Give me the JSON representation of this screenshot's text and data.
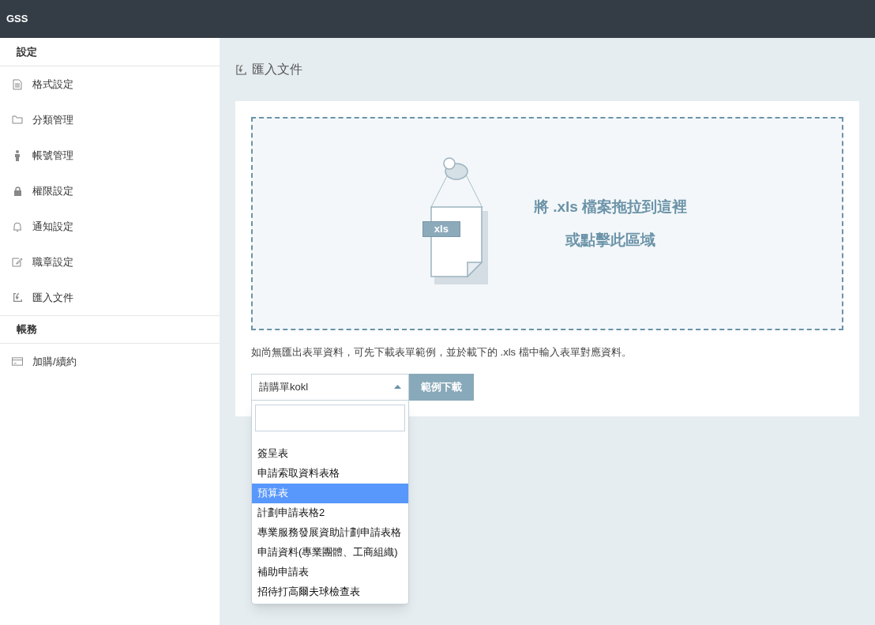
{
  "header": {
    "brand": "GSS"
  },
  "sidebar": {
    "sections": [
      {
        "title": "設定",
        "items": [
          {
            "label": "格式設定",
            "selected": false
          },
          {
            "label": "分類管理",
            "selected": false
          },
          {
            "label": "帳號管理",
            "selected": false
          },
          {
            "label": "權限設定",
            "selected": false
          },
          {
            "label": "通知設定",
            "selected": false
          },
          {
            "label": "職章設定",
            "selected": false
          },
          {
            "label": "匯入文件",
            "selected": false
          }
        ]
      },
      {
        "title": "帳務",
        "items": [
          {
            "label": "加購/續約",
            "selected": false
          }
        ]
      }
    ]
  },
  "page_title": "匯入文件",
  "dropzone": {
    "line_1": "將 .xls 檔案拖拉到這裡",
    "line_2": "或點擊此區域",
    "file_tag": "xls"
  },
  "note": "如尚無匯出表單資料，可先下載表單範例，並於載下的 .xls 檔中輸入表單對應資料。",
  "select": {
    "value": "請購單kokl",
    "expanded": true
  },
  "download_button": "範例下載",
  "options": [
    {
      "label": "簽呈表",
      "selected": false
    },
    {
      "label": "申請索取資料表格",
      "selected": false
    },
    {
      "label": "預算表",
      "selected": true
    },
    {
      "label": "計劃申請表格2",
      "selected": false
    },
    {
      "label": "專業服務發展資助計劃申請表格",
      "selected": false
    },
    {
      "label": "申請資料(專業團體、工商組織)",
      "selected": false
    },
    {
      "label": "補助申請表",
      "selected": false
    },
    {
      "label": "招待打高爾夫球檢查表",
      "selected": false
    }
  ]
}
